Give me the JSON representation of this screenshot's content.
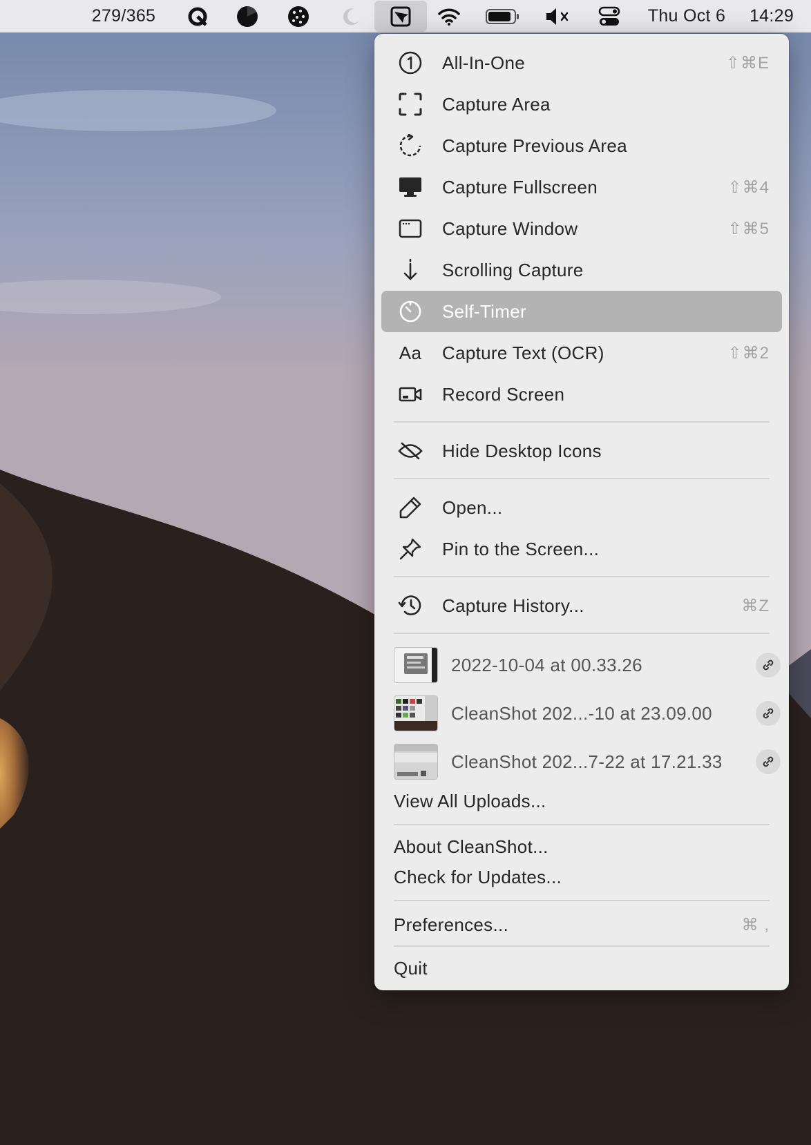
{
  "menubar": {
    "counter": "279/365",
    "date": "Thu Oct 6",
    "time": "14:29",
    "icons": [
      "quotient-icon",
      "dark-circle-icon",
      "cookie-icon",
      "moon-icon",
      "cleanshot-icon",
      "wifi-icon",
      "battery-icon",
      "muted-speaker-icon",
      "control-center-icon"
    ]
  },
  "menu": {
    "items": [
      {
        "label": "All-In-One",
        "icon": "circled-one-icon",
        "shortcut": "⇧⌘E"
      },
      {
        "label": "Capture Area",
        "icon": "capture-area-icon",
        "shortcut": ""
      },
      {
        "label": "Capture Previous Area",
        "icon": "capture-previous-icon",
        "shortcut": ""
      },
      {
        "label": "Capture Fullscreen",
        "icon": "monitor-icon",
        "shortcut": "⇧⌘4"
      },
      {
        "label": "Capture Window",
        "icon": "window-icon",
        "shortcut": "⇧⌘5"
      },
      {
        "label": "Scrolling Capture",
        "icon": "arrow-down-icon",
        "shortcut": ""
      },
      {
        "label": "Self-Timer",
        "icon": "timer-icon",
        "shortcut": "",
        "selected": true
      },
      {
        "label": "Capture Text (OCR)",
        "icon": "text-aa-icon",
        "icon_text": "Aa",
        "shortcut": "⇧⌘2"
      },
      {
        "label": "Record Screen",
        "icon": "video-camera-icon",
        "shortcut": ""
      }
    ],
    "hide_icons": {
      "label": "Hide Desktop Icons",
      "icon": "eye-slash-icon"
    },
    "open": {
      "label": "Open...",
      "icon": "pencil-icon"
    },
    "pin": {
      "label": "Pin to the Screen...",
      "icon": "pin-icon"
    },
    "history": {
      "label": "Capture History...",
      "icon": "history-icon",
      "shortcut": "⌘Z"
    },
    "uploads": [
      {
        "label": "2022-10-04 at 00.33.26",
        "icon": "link-icon"
      },
      {
        "label": "CleanShot 202...-10 at 23.09.00",
        "icon": "link-icon"
      },
      {
        "label": "CleanShot 202...7-22 at 17.21.33",
        "icon": "link-icon"
      }
    ],
    "view_all": "View All Uploads...",
    "about": "About CleanShot...",
    "updates": "Check for Updates...",
    "preferences": {
      "label": "Preferences...",
      "shortcut": "⌘ ,"
    },
    "quit": "Quit"
  },
  "colors": {
    "menubar_bg": "#e9e8ea",
    "menu_bg": "#ececec",
    "selected_bg": "#b3b3b3",
    "shortcut": "#a3a3a3"
  }
}
